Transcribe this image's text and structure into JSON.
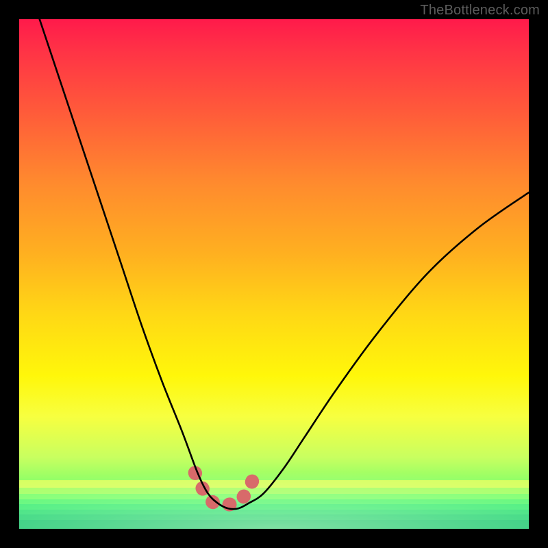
{
  "watermark": "TheBottleneck.com",
  "chart_data": {
    "type": "line",
    "title": "",
    "xlabel": "",
    "ylabel": "",
    "xlim": [
      0,
      100
    ],
    "ylim": [
      0,
      100
    ],
    "grid": false,
    "legend": false,
    "series": [
      {
        "name": "bottleneck-curve",
        "x": [
          4,
          8,
          12,
          16,
          20,
          24,
          28,
          32,
          35,
          37,
          39,
          41,
          43,
          45,
          48,
          52,
          56,
          62,
          70,
          80,
          90,
          100
        ],
        "y": [
          100,
          88,
          76,
          64,
          52,
          40,
          29,
          19,
          11,
          7,
          5,
          4,
          4,
          5,
          7,
          12,
          18,
          27,
          38,
          50,
          59,
          66
        ]
      }
    ],
    "annotations": [
      {
        "name": "trough-highlight",
        "x_range": [
          34.5,
          46.5
        ],
        "y_level": 5
      }
    ],
    "background_gradient": {
      "top": "#ff1a4b",
      "mid": "#ffd815",
      "bottom": "#15e578"
    },
    "bottom_bands": [
      {
        "y_from": 90.5,
        "y_to": 92.0,
        "color": "#d7ff62"
      },
      {
        "y_from": 92.0,
        "y_to": 93.2,
        "color": "#a6ff68"
      },
      {
        "y_from": 93.2,
        "y_to": 94.2,
        "color": "#7cff6f"
      },
      {
        "y_from": 94.2,
        "y_to": 95.2,
        "color": "#56f774"
      },
      {
        "y_from": 95.2,
        "y_to": 96.2,
        "color": "#3ced77"
      },
      {
        "y_from": 96.2,
        "y_to": 97.2,
        "color": "#2ee078"
      },
      {
        "y_from": 97.2,
        "y_to": 98.2,
        "color": "#22d476"
      },
      {
        "y_from": 98.2,
        "y_to": 100,
        "color": "#18c873"
      }
    ]
  }
}
